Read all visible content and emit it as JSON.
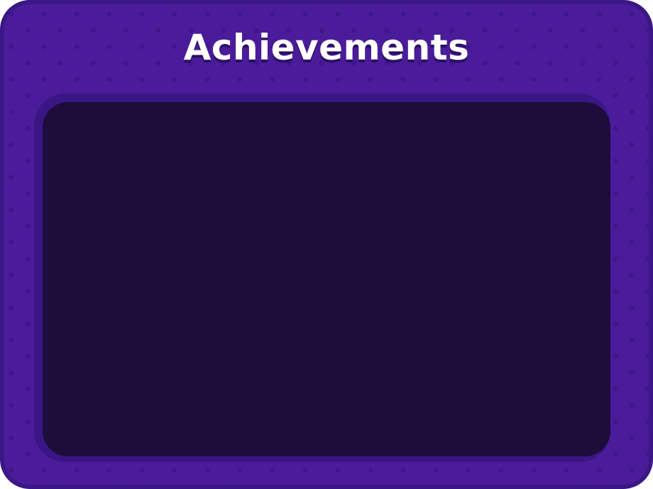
{
  "window": {
    "title": "Achievements"
  },
  "colors": {
    "panel": "#4a1c9a",
    "panel_border": "#3a1785",
    "dots": "#3e168a",
    "content_frame": "#3a1685",
    "content": "#1e0c3a",
    "title_text": "#ffffff"
  },
  "achievements": {
    "items": []
  }
}
